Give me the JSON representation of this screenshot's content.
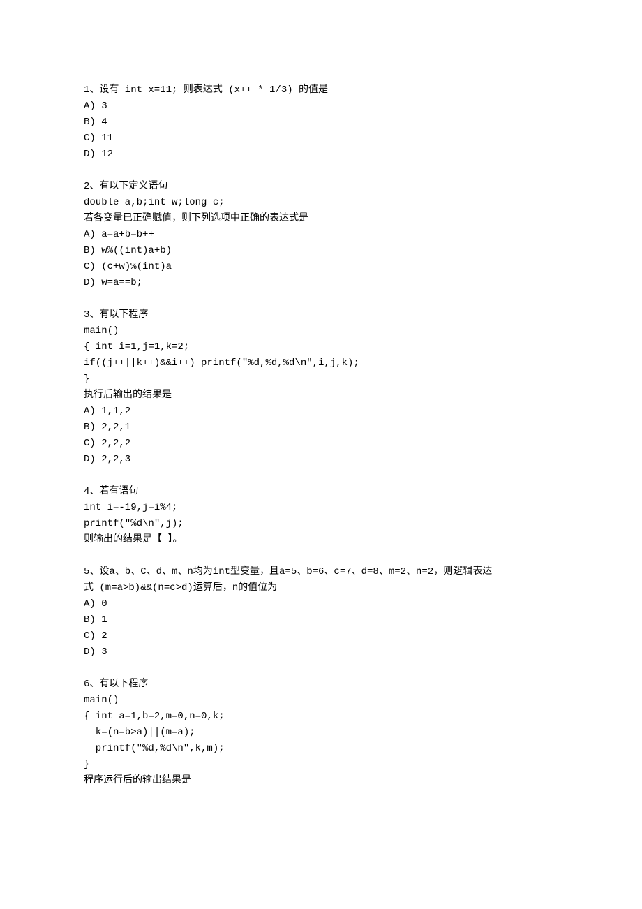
{
  "questions": [
    {
      "stem": [
        "1、设有 int x=11; 则表达式 (x++ * 1/3) 的值是"
      ],
      "options": [
        "A) 3",
        "B) 4",
        "C) 11",
        "D) 12"
      ]
    },
    {
      "stem": [
        "2、有以下定义语句",
        "double a,b;int w;long c;",
        "若各变量已正确赋值，则下列选项中正确的表达式是"
      ],
      "options": [
        "A) a=a+b=b++",
        "B) w%((int)a+b)",
        "C) (c+w)%(int)a",
        "D) w=a==b;"
      ]
    },
    {
      "stem": [
        "3、有以下程序",
        "main()",
        "{ int i=1,j=1,k=2;",
        "if((j++||k++)&&i++) printf(\"%d,%d,%d\\n\",i,j,k);",
        "}",
        "执行后输出的结果是"
      ],
      "options": [
        "A) 1,1,2",
        "B) 2,2,1",
        "C) 2,2,2",
        "D) 2,2,3"
      ]
    },
    {
      "stem": [
        "4、若有语句",
        "int i=-19,j=i%4;",
        "printf(\"%d\\n\",j);",
        "则输出的结果是【 】。"
      ],
      "options": []
    },
    {
      "stem": [
        "5、设a、b、C、d、m、n均为int型变量，且a=5、b=6、c=7、d=8、m=2、n=2，则逻辑表达",
        "式 (m=a>b)&&(n=c>d)运算后，n的值位为"
      ],
      "options": [
        "A) 0",
        "B) 1",
        "C) 2",
        "D) 3"
      ]
    },
    {
      "stem": [
        "6、有以下程序",
        "main()",
        "{ int a=1,b=2,m=0,n=0,k;",
        "  k=(n=b>a)||(m=a);",
        "  printf(\"%d,%d\\n\",k,m);",
        "}",
        "程序运行后的输出结果是"
      ],
      "options": []
    }
  ]
}
